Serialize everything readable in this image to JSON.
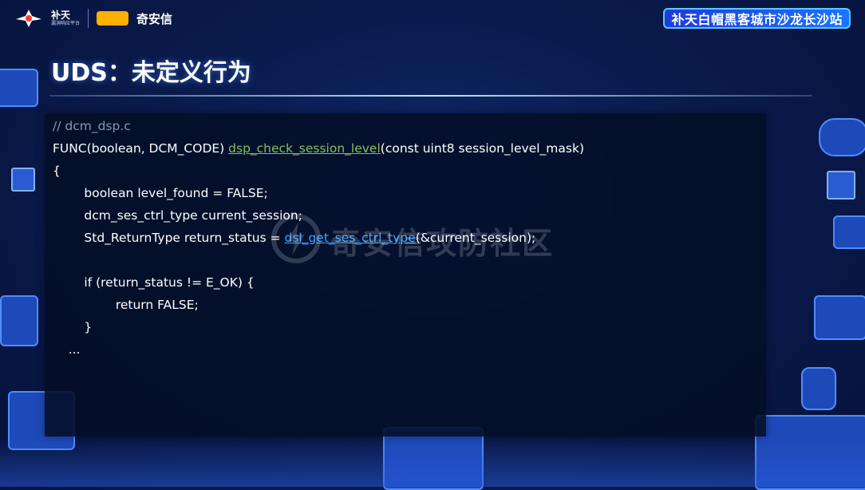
{
  "header": {
    "org_name": "补天",
    "org_subtitle": "漏洞响应平台",
    "brand_name": "奇安信",
    "event_title": "补天白帽黑客城市沙龙长沙站"
  },
  "slide": {
    "title": "UDS：未定义行为"
  },
  "code": {
    "line1": "// dcm_dsp.c",
    "line2_prefix": "FUNC(boolean, DCM_CODE) ",
    "line2_func": "dsp_check_session_level",
    "line2_suffix": "(const uint8 session_level_mask)",
    "line3": "{",
    "line4": "        boolean level_found = FALSE;",
    "line5": "        dcm_ses_ctrl_type current_session;",
    "line6_prefix": "        Std_ReturnType return_status = ",
    "line6_func": "dsl_get_ses_ctrl_type",
    "line6_suffix": "(&current_session);",
    "line7": "",
    "line8": "        if (return_status != E_OK) {",
    "line9": "                return FALSE;",
    "line10": "        }",
    "line11": "    ..."
  },
  "watermark": {
    "text": "奇安信攻防社区"
  },
  "colors": {
    "comment": "#8b97ad",
    "function_highlight": "#7ec25a",
    "call_highlight": "#3fa2ff",
    "panel_bg": "#030e26"
  }
}
